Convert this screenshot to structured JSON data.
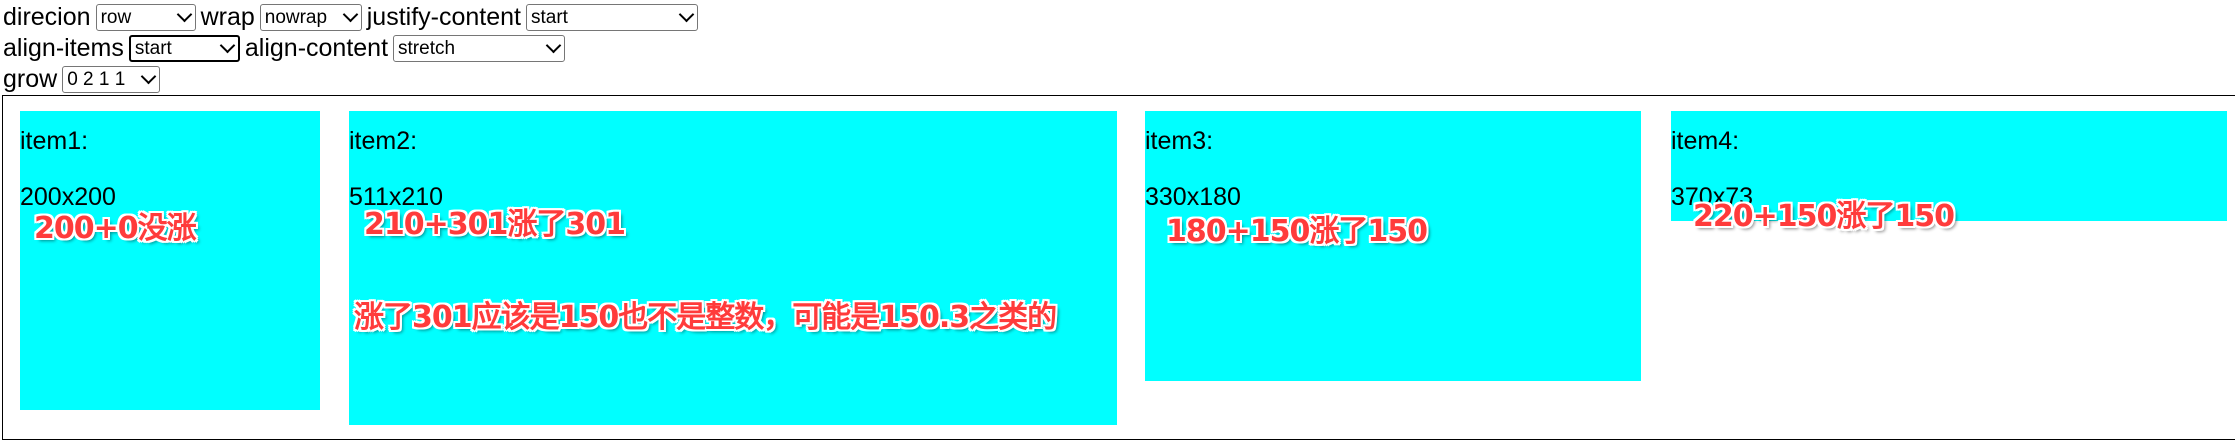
{
  "controls": {
    "direction": {
      "label": "direcion",
      "value": "row"
    },
    "wrap": {
      "label": "wrap",
      "value": "nowrap"
    },
    "justify_content": {
      "label": "justify-content",
      "value": "start"
    },
    "align_items": {
      "label": "align-items",
      "value": "start"
    },
    "align_content": {
      "label": "align-content",
      "value": "stretch"
    },
    "grow": {
      "label": "grow",
      "value": "0 2 1 1"
    }
  },
  "items": [
    {
      "title": "item1:",
      "size": "200x200",
      "note": "200+0没涨"
    },
    {
      "title": "item2:",
      "size": "511x210",
      "note": "210+301涨了301",
      "note2": "涨了301应该是150也不是整数，可能是150.3之类的"
    },
    {
      "title": "item3:",
      "size": "330x180",
      "note": "180+150涨了150"
    },
    {
      "title": "item4:",
      "size": "370x73",
      "note": "220+150涨了150"
    }
  ],
  "colors": {
    "item_background": "#00ffff",
    "annotation_text": "#ff3b3b"
  }
}
